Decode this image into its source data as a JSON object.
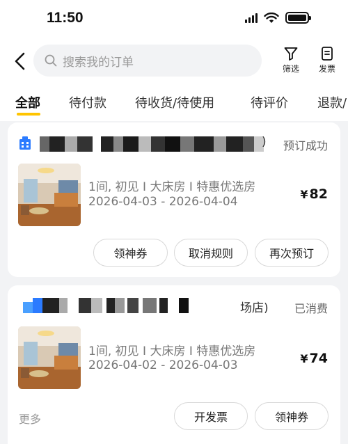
{
  "status_bar": {
    "time": "11:50"
  },
  "header": {
    "search_placeholder": "搜索我的订单",
    "filter_label": "筛选",
    "invoice_label": "发票"
  },
  "tabs": [
    {
      "label": "全部",
      "active": true
    },
    {
      "label": "待付款"
    },
    {
      "label": "待收货/待使用"
    },
    {
      "label": "待评价"
    },
    {
      "label": "退款/"
    }
  ],
  "orders": [
    {
      "hotel_name_tail": ")",
      "status": "预订成功",
      "room": "1间, 初见 I 大床房 I 特惠优选房",
      "dates": "2026-04-03 - 2026-04-04",
      "currency": "¥",
      "price": "82",
      "actions": [
        "领神券",
        "取消规则",
        "再次预订"
      ]
    },
    {
      "hotel_name_tail": "场店)",
      "status": "已消费",
      "room": "1间, 初见 I 大床房 I 特惠优选房",
      "dates": "2026-04-02 - 2026-04-03",
      "currency": "¥",
      "price": "74",
      "more_label": "更多",
      "actions": [
        "开发票",
        "领神券"
      ]
    }
  ],
  "colors": {
    "accent": "#ffc400",
    "hotel_badge": "#2b7bff"
  }
}
